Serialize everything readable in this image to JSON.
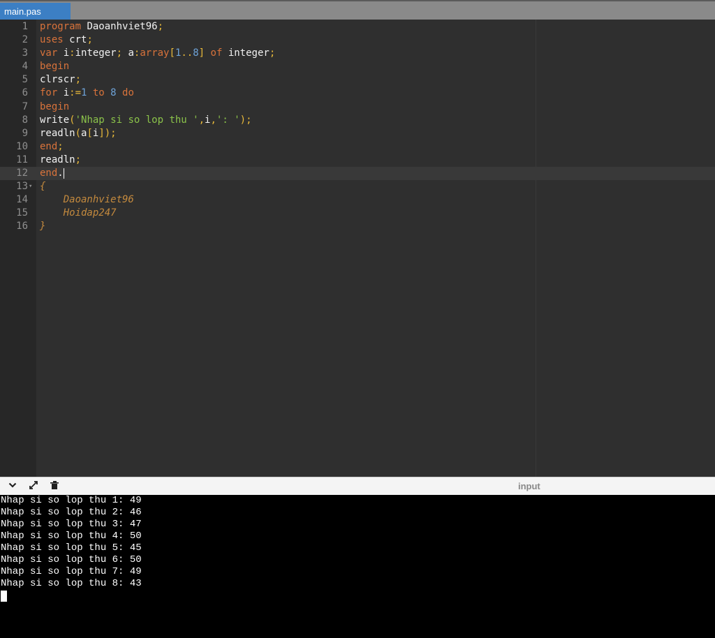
{
  "tab": {
    "label": "main.pas"
  },
  "editor": {
    "lines": [
      {
        "num": "1",
        "tokens": [
          {
            "t": "program ",
            "c": "kw"
          },
          {
            "t": "Daoanhviet96",
            "c": "id"
          },
          {
            "t": ";",
            "c": "pun"
          }
        ]
      },
      {
        "num": "2",
        "tokens": [
          {
            "t": "uses ",
            "c": "kw"
          },
          {
            "t": "crt",
            "c": "id"
          },
          {
            "t": ";",
            "c": "pun"
          }
        ]
      },
      {
        "num": "3",
        "tokens": [
          {
            "t": "var ",
            "c": "kw"
          },
          {
            "t": "i",
            "c": "id"
          },
          {
            "t": ":",
            "c": "pun"
          },
          {
            "t": "integer",
            "c": "id"
          },
          {
            "t": "; ",
            "c": "pun"
          },
          {
            "t": "a",
            "c": "id"
          },
          {
            "t": ":",
            "c": "pun"
          },
          {
            "t": "array",
            "c": "kw"
          },
          {
            "t": "[",
            "c": "pun"
          },
          {
            "t": "1",
            "c": "num"
          },
          {
            "t": "..",
            "c": "pun"
          },
          {
            "t": "8",
            "c": "num"
          },
          {
            "t": "] ",
            "c": "pun"
          },
          {
            "t": "of ",
            "c": "kw"
          },
          {
            "t": "integer",
            "c": "id"
          },
          {
            "t": ";",
            "c": "pun"
          }
        ]
      },
      {
        "num": "4",
        "tokens": [
          {
            "t": "begin",
            "c": "kw"
          }
        ]
      },
      {
        "num": "5",
        "tokens": [
          {
            "t": "clrscr",
            "c": "id"
          },
          {
            "t": ";",
            "c": "pun"
          }
        ]
      },
      {
        "num": "6",
        "tokens": [
          {
            "t": "for ",
            "c": "kw"
          },
          {
            "t": "i",
            "c": "id"
          },
          {
            "t": ":=",
            "c": "pun"
          },
          {
            "t": "1 ",
            "c": "num"
          },
          {
            "t": "to ",
            "c": "kw"
          },
          {
            "t": "8 ",
            "c": "num"
          },
          {
            "t": "do",
            "c": "kw"
          }
        ]
      },
      {
        "num": "7",
        "tokens": [
          {
            "t": "begin",
            "c": "kw"
          }
        ]
      },
      {
        "num": "8",
        "tokens": [
          {
            "t": "write",
            "c": "id"
          },
          {
            "t": "(",
            "c": "pun"
          },
          {
            "t": "'Nhap si so lop thu '",
            "c": "str"
          },
          {
            "t": ",",
            "c": "pun"
          },
          {
            "t": "i",
            "c": "id"
          },
          {
            "t": ",",
            "c": "pun"
          },
          {
            "t": "': '",
            "c": "str"
          },
          {
            "t": ");",
            "c": "pun"
          }
        ]
      },
      {
        "num": "9",
        "tokens": [
          {
            "t": "readln",
            "c": "id"
          },
          {
            "t": "(",
            "c": "pun"
          },
          {
            "t": "a",
            "c": "id"
          },
          {
            "t": "[",
            "c": "pun"
          },
          {
            "t": "i",
            "c": "id"
          },
          {
            "t": "]);",
            "c": "pun"
          }
        ]
      },
      {
        "num": "10",
        "tokens": [
          {
            "t": "end",
            "c": "kw"
          },
          {
            "t": ";",
            "c": "pun"
          }
        ]
      },
      {
        "num": "11",
        "tokens": [
          {
            "t": "readln",
            "c": "id"
          },
          {
            "t": ";",
            "c": "pun"
          }
        ]
      },
      {
        "num": "12",
        "tokens": [
          {
            "t": "end",
            "c": "kw"
          },
          {
            "t": ".",
            "c": "id"
          }
        ],
        "active": true,
        "cursor": true
      },
      {
        "num": "13",
        "fold": "▾",
        "tokens": [
          {
            "t": "{",
            "c": "cm"
          }
        ]
      },
      {
        "num": "14",
        "tokens": [
          {
            "t": "    Daoanhviet96",
            "c": "cm"
          }
        ]
      },
      {
        "num": "15",
        "tokens": [
          {
            "t": "    Hoidap247",
            "c": "cm"
          }
        ]
      },
      {
        "num": "16",
        "tokens": [
          {
            "t": "}",
            "c": "cm"
          }
        ]
      }
    ]
  },
  "panel": {
    "label": "input",
    "icons": [
      "chevron-down-icon",
      "expand-icon",
      "clear-console-icon"
    ]
  },
  "console": {
    "lines": [
      "Nhap si so lop thu 1: 49",
      "Nhap si so lop thu 2: 46",
      "Nhap si so lop thu 3: 47",
      "Nhap si so lop thu 4: 50",
      "Nhap si so lop thu 5: 45",
      "Nhap si so lop thu 6: 50",
      "Nhap si so lop thu 7: 49",
      "Nhap si so lop thu 8: 43"
    ]
  },
  "colors": {
    "tab": "#3c7fc4",
    "editor_bg": "#2f2f2f",
    "keyword": "#d9733b",
    "number": "#6ea3d8",
    "string": "#8bc34a",
    "comment": "#c48a3e"
  }
}
